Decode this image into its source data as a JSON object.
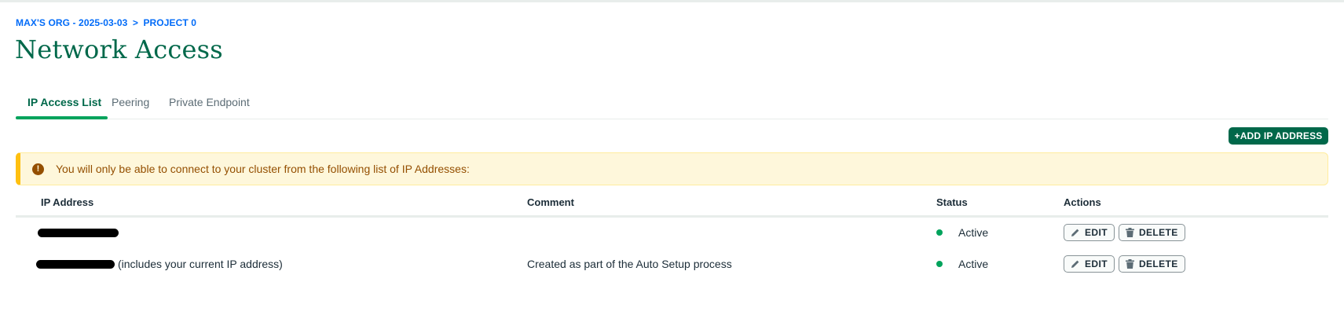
{
  "breadcrumb": {
    "org": "MAX'S ORG - 2025-03-03",
    "separator": ">",
    "project": "PROJECT 0"
  },
  "page": {
    "title": "Network Access"
  },
  "tabs": [
    {
      "label": "IP Access List",
      "active": true
    },
    {
      "label": "Peering",
      "active": false
    },
    {
      "label": "Private Endpoint",
      "active": false
    }
  ],
  "actions": {
    "add_ip_label": "+ADD IP ADDRESS"
  },
  "banner": {
    "icon": "!",
    "text": "You will only be able to connect to your cluster from the following list of IP Addresses:"
  },
  "table": {
    "headers": [
      "IP Address",
      "Comment",
      "Status",
      "Actions"
    ],
    "rows": [
      {
        "ip_note": "",
        "comment": "",
        "status": "Active",
        "edit": "EDIT",
        "delete": "DELETE"
      },
      {
        "ip_note": "(includes your current IP address)",
        "comment": "Created as part of the Auto Setup process",
        "status": "Active",
        "edit": "EDIT",
        "delete": "DELETE"
      }
    ]
  },
  "colors": {
    "brand_green": "#00684a",
    "status_active": "#00a35c",
    "link_blue": "#016bf8",
    "warning_text": "#944f01",
    "warning_bg": "#fef7db"
  }
}
